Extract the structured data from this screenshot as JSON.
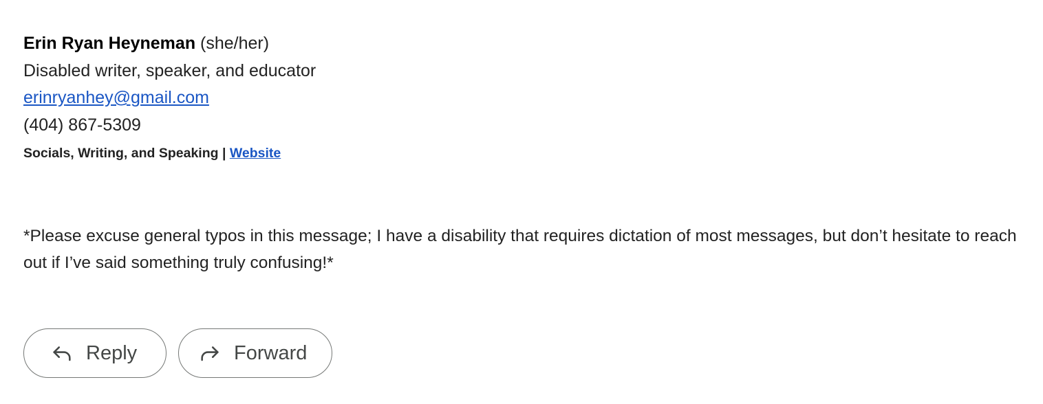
{
  "signature": {
    "name": "Erin Ryan Heyneman",
    "pronouns": "(she/her)",
    "title": "Disabled writer, speaker, and educator",
    "email": "erinryanhey@gmail.com",
    "phone": "(404) 867-5309",
    "links_prefix": "Socials, Writing, and Speaking | ",
    "website_label": "Website"
  },
  "note": "*Please excuse general typos in this message; I have a disability that requires dictation of most messages, but don’t hesitate to reach out if I’ve said something truly confusing!*",
  "actions": {
    "reply_label": "Reply",
    "reply_icon": "reply-arrow-icon",
    "forward_label": "Forward",
    "forward_icon": "forward-arrow-icon"
  },
  "colors": {
    "link": "#1a56c4",
    "text": "#222222",
    "button_border": "#747775"
  }
}
